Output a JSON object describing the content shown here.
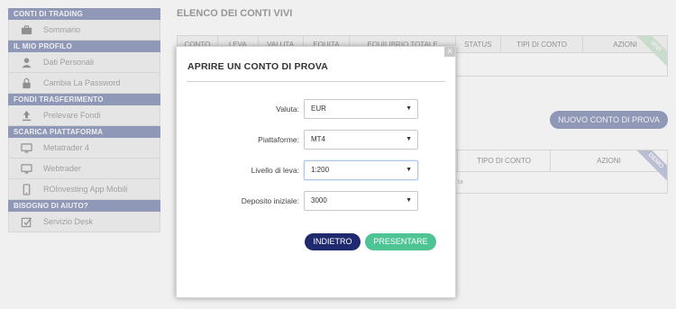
{
  "sidebar": {
    "sections": [
      {
        "title": "CONTI DI TRADING",
        "items": [
          {
            "label": "Sommario",
            "icon": "briefcase-icon"
          }
        ]
      },
      {
        "title": "IL MIO PROFILO",
        "items": [
          {
            "label": "Dati Personali",
            "icon": "user-icon"
          },
          {
            "label": "Cambia La Password",
            "icon": "lock-icon"
          }
        ]
      },
      {
        "title": "FONDI TRASFERIMENTO",
        "items": [
          {
            "label": "Prelevare Fondi",
            "icon": "upload-icon"
          }
        ]
      },
      {
        "title": "SCARICA PIATTAFORMA",
        "items": [
          {
            "label": "Metatrader 4",
            "icon": "monitor-icon"
          },
          {
            "label": "Webtrader",
            "icon": "monitor-icon"
          },
          {
            "label": "ROInvesting App Mobili",
            "icon": "mobile-icon"
          }
        ]
      },
      {
        "title": "BISOGNO DI AIUTO?",
        "items": [
          {
            "label": "Servizio Desk",
            "icon": "checkbox-icon"
          }
        ]
      }
    ]
  },
  "main": {
    "title": "ELENCO DEI CONTI VIVI",
    "live_table": {
      "columns": [
        "CONTO",
        "LEVA",
        "VALUTA",
        "EQUITA",
        "EQUILIBRIO TOTALE",
        "STATUS",
        "TIPI DI CONTO",
        "AZIONI"
      ],
      "ribbon": "VIVI"
    },
    "new_demo_button": "NUOVO CONTO DI PROVA",
    "demo_table": {
      "columns": [
        "TIPO DI CONTO",
        "AZIONI"
      ],
      "ribbon": "DEMO",
      "row_note": "ta"
    }
  },
  "modal": {
    "title": "APRIRE UN CONTO DI PROVA",
    "close": "×",
    "fields": {
      "currency": {
        "label": "Valuta:",
        "value": "EUR"
      },
      "platform": {
        "label": "Piattaforme:",
        "value": "MT4"
      },
      "leverage": {
        "label": "Livello di leva:",
        "value": "1:200"
      },
      "deposit": {
        "label": "Deposito iniziale:",
        "value": "3000"
      }
    },
    "back_button": "INDIETRO",
    "submit_button": "PRESENTARE"
  },
  "colors": {
    "sidebar_header": "#9aa2c3",
    "back_button": "#1f2a6e",
    "submit_button": "#4ec495"
  }
}
